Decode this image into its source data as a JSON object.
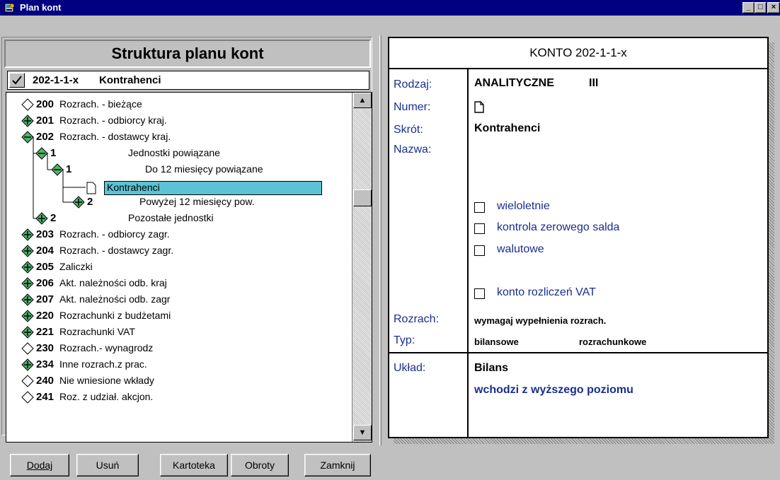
{
  "window": {
    "title": "Plan kont",
    "buttons": [
      "_",
      "□",
      "×"
    ]
  },
  "left": {
    "heading": "Struktura planu kont",
    "selected": {
      "code": "202-1-1-x",
      "name": "Kontrahenci"
    },
    "tree": [
      {
        "code": "200",
        "label": "Rozrach. - bieżące",
        "icon": "empty-diamond"
      },
      {
        "code": "201",
        "label": "Rozrach. - odbiorcy kraj.",
        "icon": "plus-diamond"
      },
      {
        "code": "202",
        "label": "Rozrach. - dostawcy kraj.",
        "icon": "minus-diamond"
      },
      {
        "code": "1",
        "label": "Jednostki powiązane",
        "icon": "minus-diamond"
      },
      {
        "code": "1",
        "label": "Do 12 miesięcy powiązane",
        "icon": "minus-diamond"
      },
      {
        "code": "",
        "label": "Kontrahenci",
        "icon": "document"
      },
      {
        "code": "2",
        "label": "Powyżej 12 miesięcy pow.",
        "icon": "plus-diamond"
      },
      {
        "code": "2",
        "label": "Pozostałe jednostki",
        "icon": "plus-diamond"
      },
      {
        "code": "203",
        "label": "Rozrach. - odbiorcy zagr.",
        "icon": "plus-diamond"
      },
      {
        "code": "204",
        "label": "Rozrach. - dostawcy zagr.",
        "icon": "plus-diamond"
      },
      {
        "code": "205",
        "label": "Zaliczki",
        "icon": "plus-diamond"
      },
      {
        "code": "206",
        "label": "Akt. należności odb. kraj",
        "icon": "plus-diamond"
      },
      {
        "code": "207",
        "label": "Akt. należności odb. zagr",
        "icon": "plus-diamond"
      },
      {
        "code": "220",
        "label": "Rozrachunki z budżetami",
        "icon": "plus-diamond"
      },
      {
        "code": "221",
        "label": "Rozrachunki VAT",
        "icon": "plus-diamond"
      },
      {
        "code": "230",
        "label": "Rozrach.- wynagrodz",
        "icon": "empty-diamond"
      },
      {
        "code": "234",
        "label": "Inne rozrach.z prac.",
        "icon": "plus-diamond"
      },
      {
        "code": "240",
        "label": "Nie wniesione wkłady",
        "icon": "empty-diamond"
      },
      {
        "code": "241",
        "label": "Roz. z udział. akcjon.",
        "icon": "empty-diamond"
      }
    ],
    "buttons": {
      "add": "Dodaj",
      "remove": "Usuń",
      "card": "Kartoteka",
      "turnover": "Obroty",
      "close": "Zamknij"
    }
  },
  "right": {
    "header": "KONTO  202-1-1-x",
    "labels": {
      "type": "Rodzaj:",
      "number": "Numer:",
      "short": "Skrót:",
      "name": "Nazwa:",
      "settlement": "Rozrach:",
      "kind": "Typ:",
      "layout": "Układ:"
    },
    "values": {
      "type": "ANALITYCZNE",
      "level": "III",
      "short": "Kontrahenci",
      "settlement": "wymagaj wypełnienia rozrach.",
      "kind1": "bilansowe",
      "kind2": "rozrachunkowe",
      "layout": "Bilans",
      "layout_sub": "wchodzi z wyższego poziomu"
    },
    "checkboxes": {
      "multiyear": "wieloletnie",
      "zero_balance": "kontrola zerowego salda",
      "currency": "walutowe",
      "vat": "konto rozliczeń VAT"
    }
  },
  "colors": {
    "titlebar": "#000080",
    "selection": "#5bc3d3",
    "label_blue": "#1a2e8c",
    "node_green": "#4fb36b"
  }
}
